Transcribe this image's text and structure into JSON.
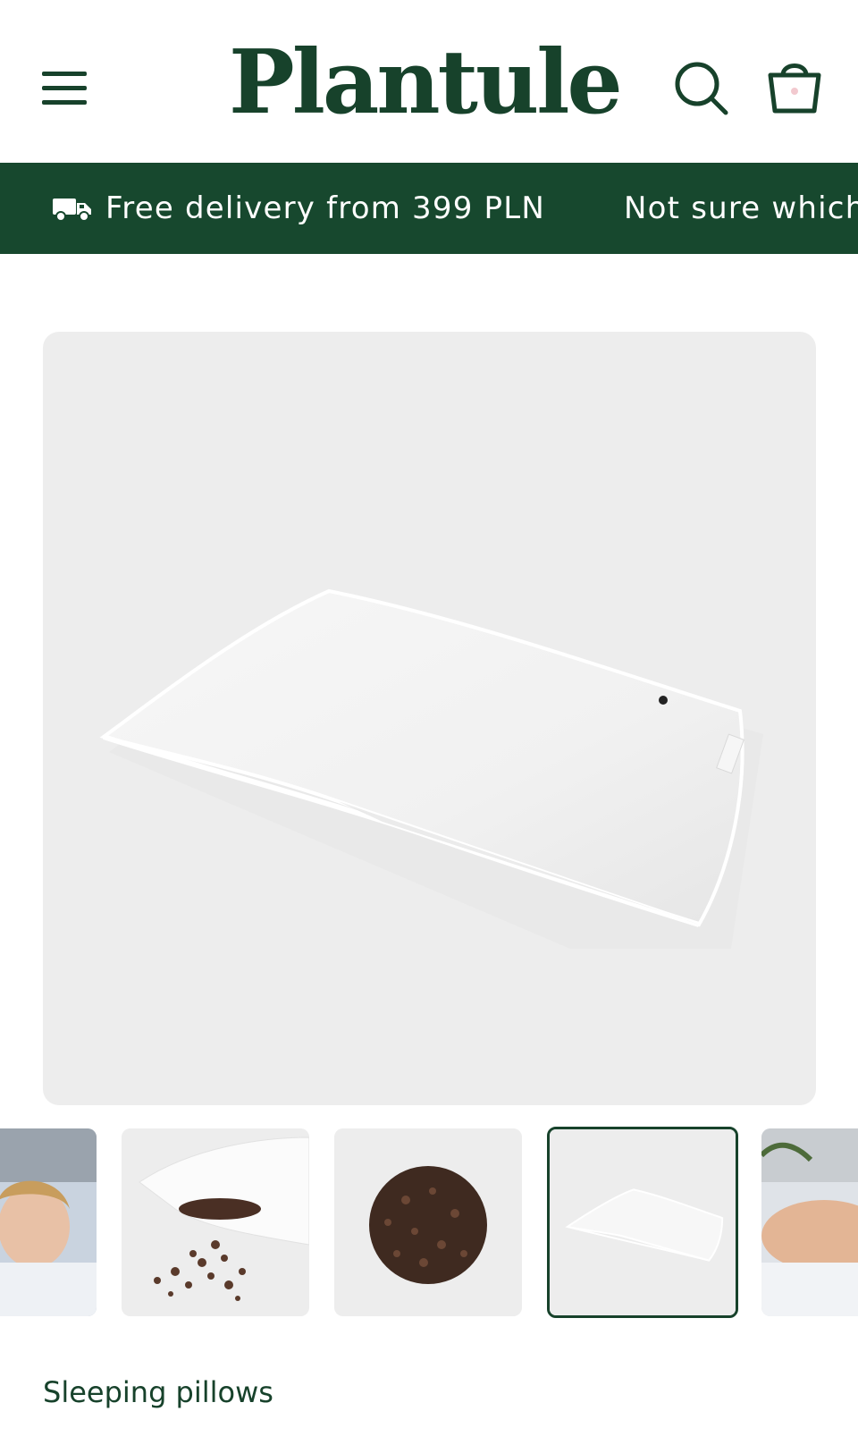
{
  "header": {
    "logo": "Plantule"
  },
  "announcement": {
    "items": [
      "Free delivery from 399 PLN",
      "Not sure which"
    ]
  },
  "product": {
    "category": "Sleeping pillows",
    "thumbnails": [
      "woman-on-pillow",
      "open-pillow-with-husks",
      "buckwheat-husks-pile",
      "white-pillow",
      "person-on-pillow"
    ],
    "active_thumbnail": 4
  },
  "colors": {
    "brand_green": "#17422b",
    "banner_green": "#17482e",
    "image_bg": "#ededed"
  }
}
